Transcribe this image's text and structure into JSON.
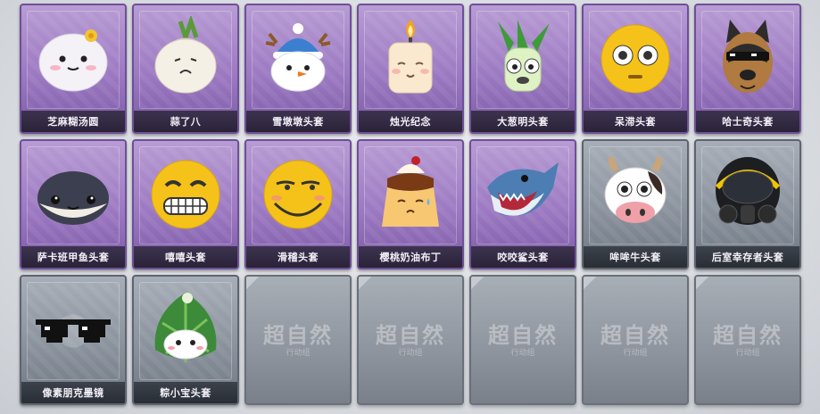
{
  "items": [
    {
      "label": "芝麻糊汤圆",
      "tier": "purple",
      "icon": "tangyuan-mask-icon"
    },
    {
      "label": "蒜了八",
      "tier": "purple",
      "icon": "garlic-mask-icon"
    },
    {
      "label": "雪墩墩头套",
      "tier": "purple",
      "icon": "snowman-mask-icon"
    },
    {
      "label": "烛光纪念",
      "tier": "purple",
      "icon": "candle-mask-icon"
    },
    {
      "label": "大葱明头套",
      "tier": "purple",
      "icon": "scallion-mask-icon"
    },
    {
      "label": "呆滞头套",
      "tier": "purple",
      "icon": "dazed-face-mask-icon"
    },
    {
      "label": "哈士奇头套",
      "tier": "purple",
      "icon": "husky-mask-icon"
    },
    {
      "label": "萨卡班甲鱼头套",
      "tier": "purple",
      "icon": "fish-mask-icon"
    },
    {
      "label": "嘻嘻头套",
      "tier": "purple",
      "icon": "grin-face-mask-icon"
    },
    {
      "label": "滑稽头套",
      "tier": "purple",
      "icon": "smirk-face-mask-icon"
    },
    {
      "label": "樱桃奶油布丁",
      "tier": "purple",
      "icon": "pudding-mask-icon"
    },
    {
      "label": "咬咬鲨头套",
      "tier": "purple",
      "icon": "shark-mask-icon"
    },
    {
      "label": "哞哞牛头套",
      "tier": "grey",
      "icon": "cow-mask-icon"
    },
    {
      "label": "后室幸存者头套",
      "tier": "grey",
      "icon": "gas-mask-icon"
    },
    {
      "label": "像素朋克墨镜",
      "tier": "grey",
      "icon": "pixel-sunglasses-icon"
    },
    {
      "label": "粽小宝头套",
      "tier": "grey",
      "icon": "zongzi-mask-icon"
    }
  ],
  "locked_slots": [
    {
      "watermark": "超自然",
      "sub": "行动组"
    },
    {
      "watermark": "超自然",
      "sub": "行动组"
    },
    {
      "watermark": "超自然",
      "sub": "行动组"
    },
    {
      "watermark": "超自然",
      "sub": "行动组"
    },
    {
      "watermark": "超自然",
      "sub": "行动组"
    }
  ],
  "colors": {
    "purple_tier": "#9c79c2",
    "grey_tier": "#8a929d",
    "label_bg": "#2a2338"
  }
}
